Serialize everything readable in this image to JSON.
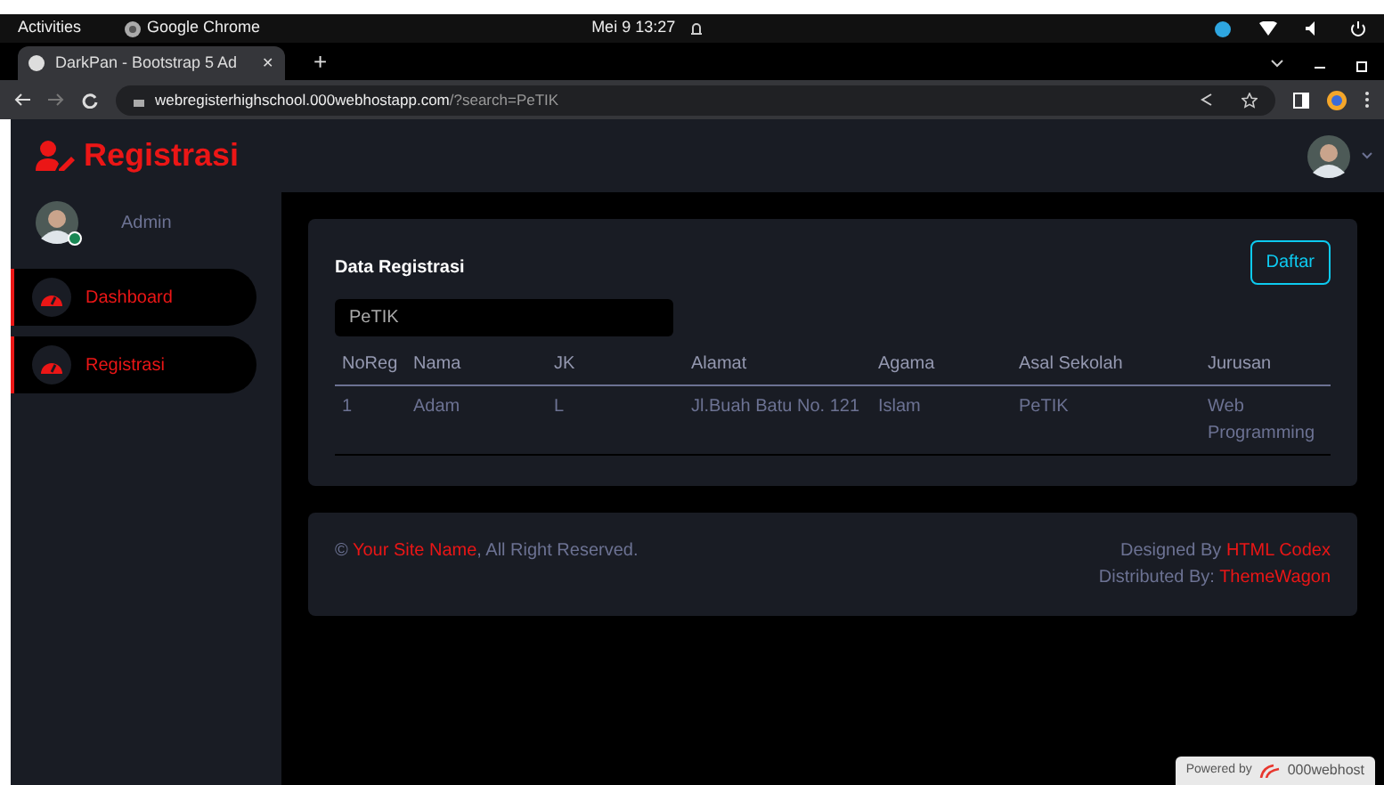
{
  "desktop_bar": {
    "activities": "Activities",
    "app": "Google Chrome",
    "clock": "Mei 9  13:27"
  },
  "browser": {
    "tab_title": "DarkPan - Bootstrap 5 Ad",
    "tab_close": "✕",
    "new_tab": "+",
    "url_host": "webregisterhighschool.000webhostapp.com",
    "url_path": "/?search=PeTIK"
  },
  "app": {
    "brand": "Registrasi",
    "user_name": "Admin",
    "user_online": true,
    "nav": [
      {
        "label": "Dashboard",
        "selected": true
      },
      {
        "label": "Registrasi",
        "selected": true
      }
    ],
    "card": {
      "title": "Data Registrasi",
      "button": "Daftar",
      "search_value": "PeTIK",
      "table": {
        "columns": [
          "NoReg",
          "Nama",
          "JK",
          "Alamat",
          "Agama",
          "Asal Sekolah",
          "Jurusan"
        ],
        "rows": [
          [
            "1",
            "Adam",
            "L",
            "Jl.Buah Batu No. 121",
            "Islam",
            "PeTIK",
            "Web Programming"
          ]
        ]
      }
    },
    "footer": {
      "left": [
        {
          "text": "©",
          "link": false
        },
        {
          "text": "Your Site Name",
          "link": true
        },
        {
          "text": ", All Right Reserved.",
          "link": false
        }
      ],
      "lines": [
        [
          {
            "text": "Designed By",
            "link": false
          },
          {
            "text": "HTML Codex",
            "link": true
          }
        ],
        [
          {
            "text": "Distributed By:",
            "link": false
          },
          {
            "text": "ThemeWagon",
            "link": true
          }
        ]
      ]
    },
    "powered": {
      "label": "Powered by",
      "brand": "000webhost"
    }
  }
}
